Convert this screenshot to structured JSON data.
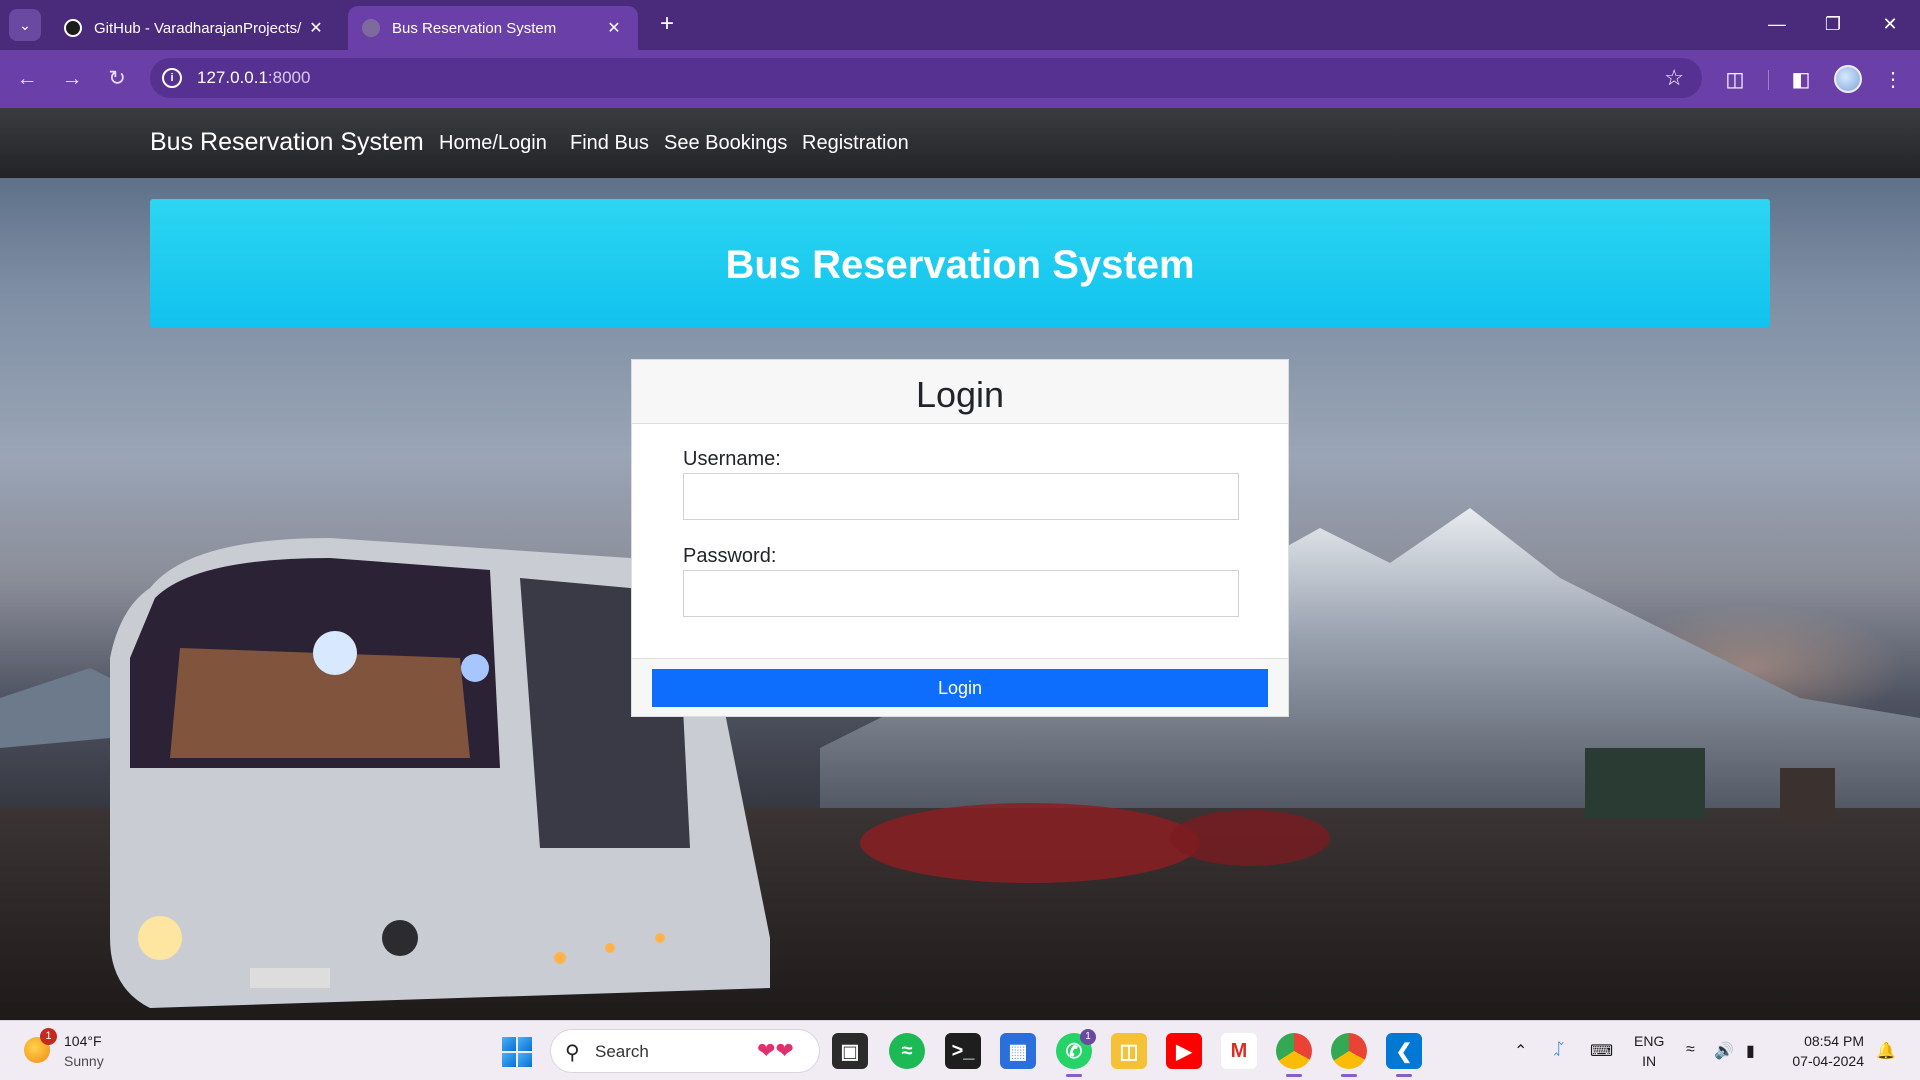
{
  "browser": {
    "tabs": [
      {
        "title": "GitHub - VaradharajanProjects/",
        "active": false
      },
      {
        "title": "Bus Reservation System",
        "active": true
      }
    ],
    "url_host": "127.0.0.1",
    "url_port": ":8000",
    "colors": {
      "frame": "#4a2a7a",
      "toolbar": "#6b3fa8"
    }
  },
  "site": {
    "brand": "Bus Reservation System",
    "nav": [
      "Home/Login",
      "Find Bus",
      "See Bookings",
      "Registration"
    ],
    "hero_title": "Bus Reservation System",
    "colors": {
      "hero": "#1ac8f0",
      "primary_button": "#0d6efd"
    }
  },
  "login": {
    "title": "Login",
    "username_label": "Username:",
    "username_value": "",
    "password_label": "Password:",
    "password_value": "",
    "submit_label": "Login"
  },
  "taskbar": {
    "weather_badge": "1",
    "temperature": "104°F",
    "condition": "Sunny",
    "search_label": "Search",
    "whatsapp_badge": "1",
    "language": "ENG",
    "region": "IN",
    "time": "08:54 PM",
    "date": "07-04-2024"
  }
}
